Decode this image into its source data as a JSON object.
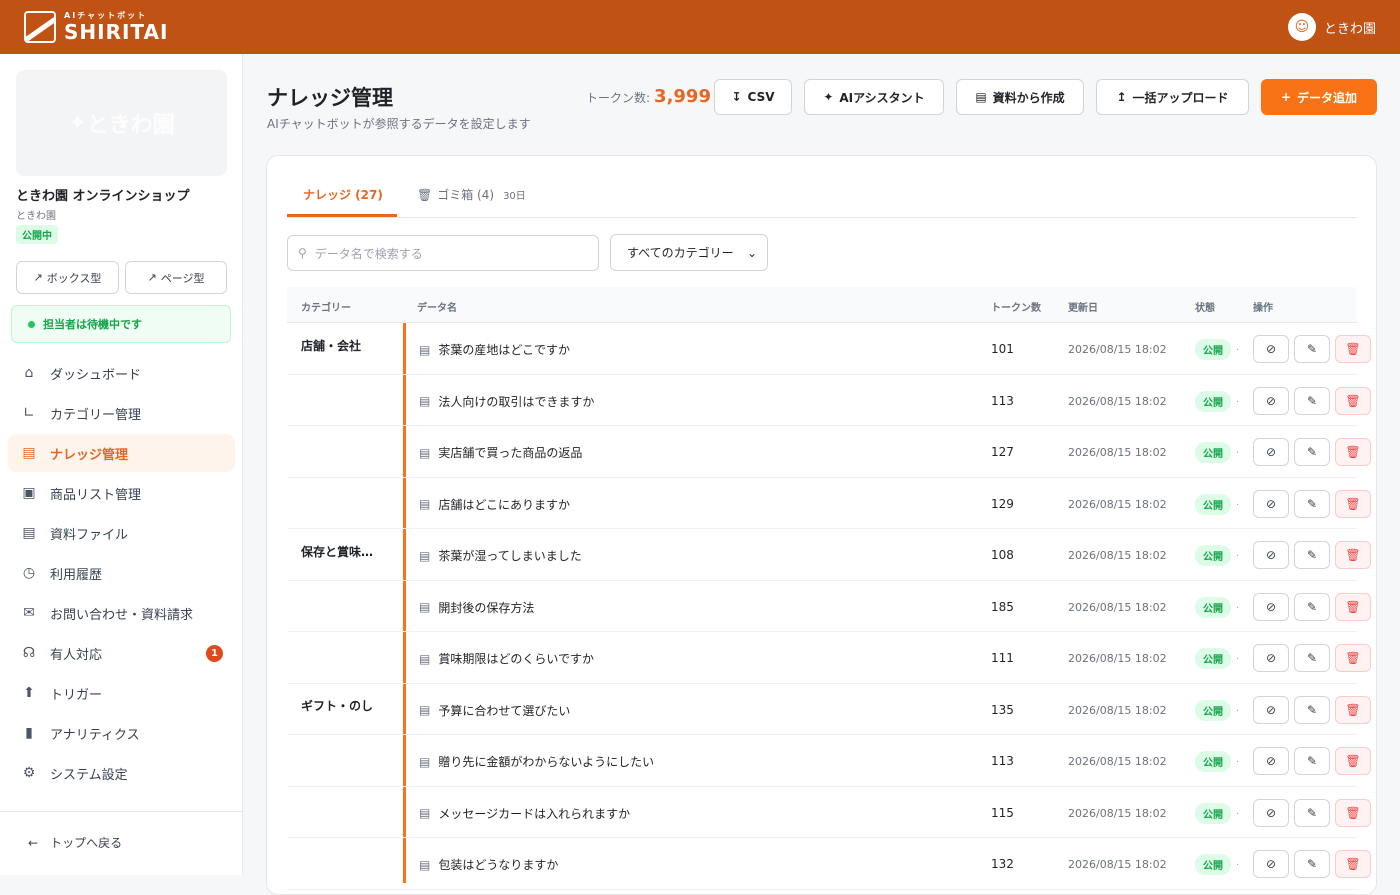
{
  "header": {
    "logo_sub": "AIチャットボット",
    "logo_main": "SHIRITAI",
    "user_name": "ときわ園"
  },
  "sidebar": {
    "brand_card_text": "ときわ園",
    "shop_name": "ときわ園 オンラインショップ",
    "shop_sub": "ときわ園",
    "status_badge": "公開中",
    "box_button": "ボックス型",
    "page_button": "ページ型",
    "agent_status": "担当者は待機中です",
    "items": [
      {
        "label": "ダッシュボード",
        "icon": "home-icon"
      },
      {
        "label": "カテゴリー管理",
        "icon": "category-tree-icon"
      },
      {
        "label": "ナレッジ管理",
        "icon": "book-open-icon"
      },
      {
        "label": "商品リスト管理",
        "icon": "shopping-bag-icon"
      },
      {
        "label": "資料ファイル",
        "icon": "file-icon"
      },
      {
        "label": "利用履歴",
        "icon": "clock-icon"
      },
      {
        "label": "お問い合わせ・資料請求",
        "icon": "mail-icon"
      },
      {
        "label": "有人対応",
        "icon": "headset-icon",
        "badge": "1"
      },
      {
        "label": "トリガー",
        "icon": "zap-icon"
      },
      {
        "label": "アナリティクス",
        "icon": "bar-chart-icon"
      },
      {
        "label": "システム設定",
        "icon": "gear-icon"
      }
    ],
    "active_index": 2,
    "back_link": "トップへ戻る"
  },
  "main": {
    "title": "ナレッジ管理",
    "subtitle": "AIチャットボットが参照するデータを設定します",
    "token_label": "トークン数:",
    "token_value": "3,999",
    "buttons": {
      "csv": "CSV",
      "assistant": "AIアシスタント",
      "from_doc": "資料から作成",
      "bulk_upload": "一括アップロード",
      "add_data": "データ追加"
    },
    "tabs": {
      "knowledge": "ナレッジ (27)",
      "trash": "ゴミ箱 (4)",
      "trash_note": "30日"
    },
    "search_placeholder": "データ名で検索する",
    "category_select": "すべてのカテゴリー",
    "table": {
      "headers": {
        "category": "カテゴリー",
        "name": "データ名",
        "tokens": "トークン数",
        "updated": "更新日",
        "status": "状態",
        "actions": "操作"
      },
      "categories": [
        "店舗・会社",
        "保存と賞味…",
        "ギフト・のし"
      ],
      "rows": [
        {
          "name": "茶葉の産地はどこですか",
          "tokens": "101",
          "date": "2026/08/15 18:02",
          "status": "公開"
        },
        {
          "name": "法人向けの取引はできますか",
          "tokens": "113",
          "date": "2026/08/15 18:02",
          "status": "公開"
        },
        {
          "name": "実店舗で買った商品の返品",
          "tokens": "127",
          "date": "2026/08/15 18:02",
          "status": "公開"
        },
        {
          "name": "店舗はどこにありますか",
          "tokens": "129",
          "date": "2026/08/15 18:02",
          "status": "公開"
        },
        {
          "name": "茶葉が湿ってしまいました",
          "tokens": "108",
          "date": "2026/08/15 18:02",
          "status": "公開"
        },
        {
          "name": "開封後の保存方法",
          "tokens": "185",
          "date": "2026/08/15 18:02",
          "status": "公開"
        },
        {
          "name": "賞味期限はどのくらいですか",
          "tokens": "111",
          "date": "2026/08/15 18:02",
          "status": "公開"
        },
        {
          "name": "予算に合わせて選びたい",
          "tokens": "135",
          "date": "2026/08/15 18:02",
          "status": "公開"
        },
        {
          "name": "贈り先に金額がわからないようにしたい",
          "tokens": "113",
          "date": "2026/08/15 18:02",
          "status": "公開"
        },
        {
          "name": "メッセージカードは入れられますか",
          "tokens": "115",
          "date": "2026/08/15 18:02",
          "status": "公開"
        },
        {
          "name": "包装はどうなりますか",
          "tokens": "132",
          "date": "2026/08/15 18:02",
          "status": "公開"
        }
      ]
    }
  },
  "colors": {
    "header_bg": "#c05214",
    "accent": "#f97316",
    "success": "#16a34a"
  }
}
